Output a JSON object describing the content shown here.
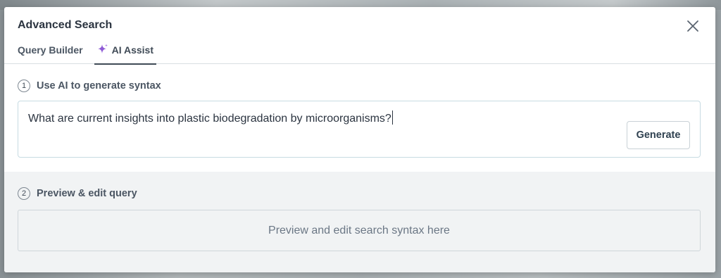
{
  "dialog": {
    "title": "Advanced Search"
  },
  "tabs": [
    {
      "label": "Query Builder",
      "active": false
    },
    {
      "label": "AI Assist",
      "active": true,
      "icon": "sparkle-icon"
    }
  ],
  "step1": {
    "number": "1",
    "label": "Use AI to generate syntax",
    "query_value": "What are current insights into plastic biodegradation by microorganisms?",
    "generate_label": "Generate"
  },
  "step2": {
    "number": "2",
    "label": "Preview & edit query",
    "placeholder": "Preview and edit search syntax here"
  },
  "colors": {
    "accent_sparkle": "#8f5bd6",
    "text_dark": "#2b3440",
    "panel_bg": "#f1f3f4"
  }
}
